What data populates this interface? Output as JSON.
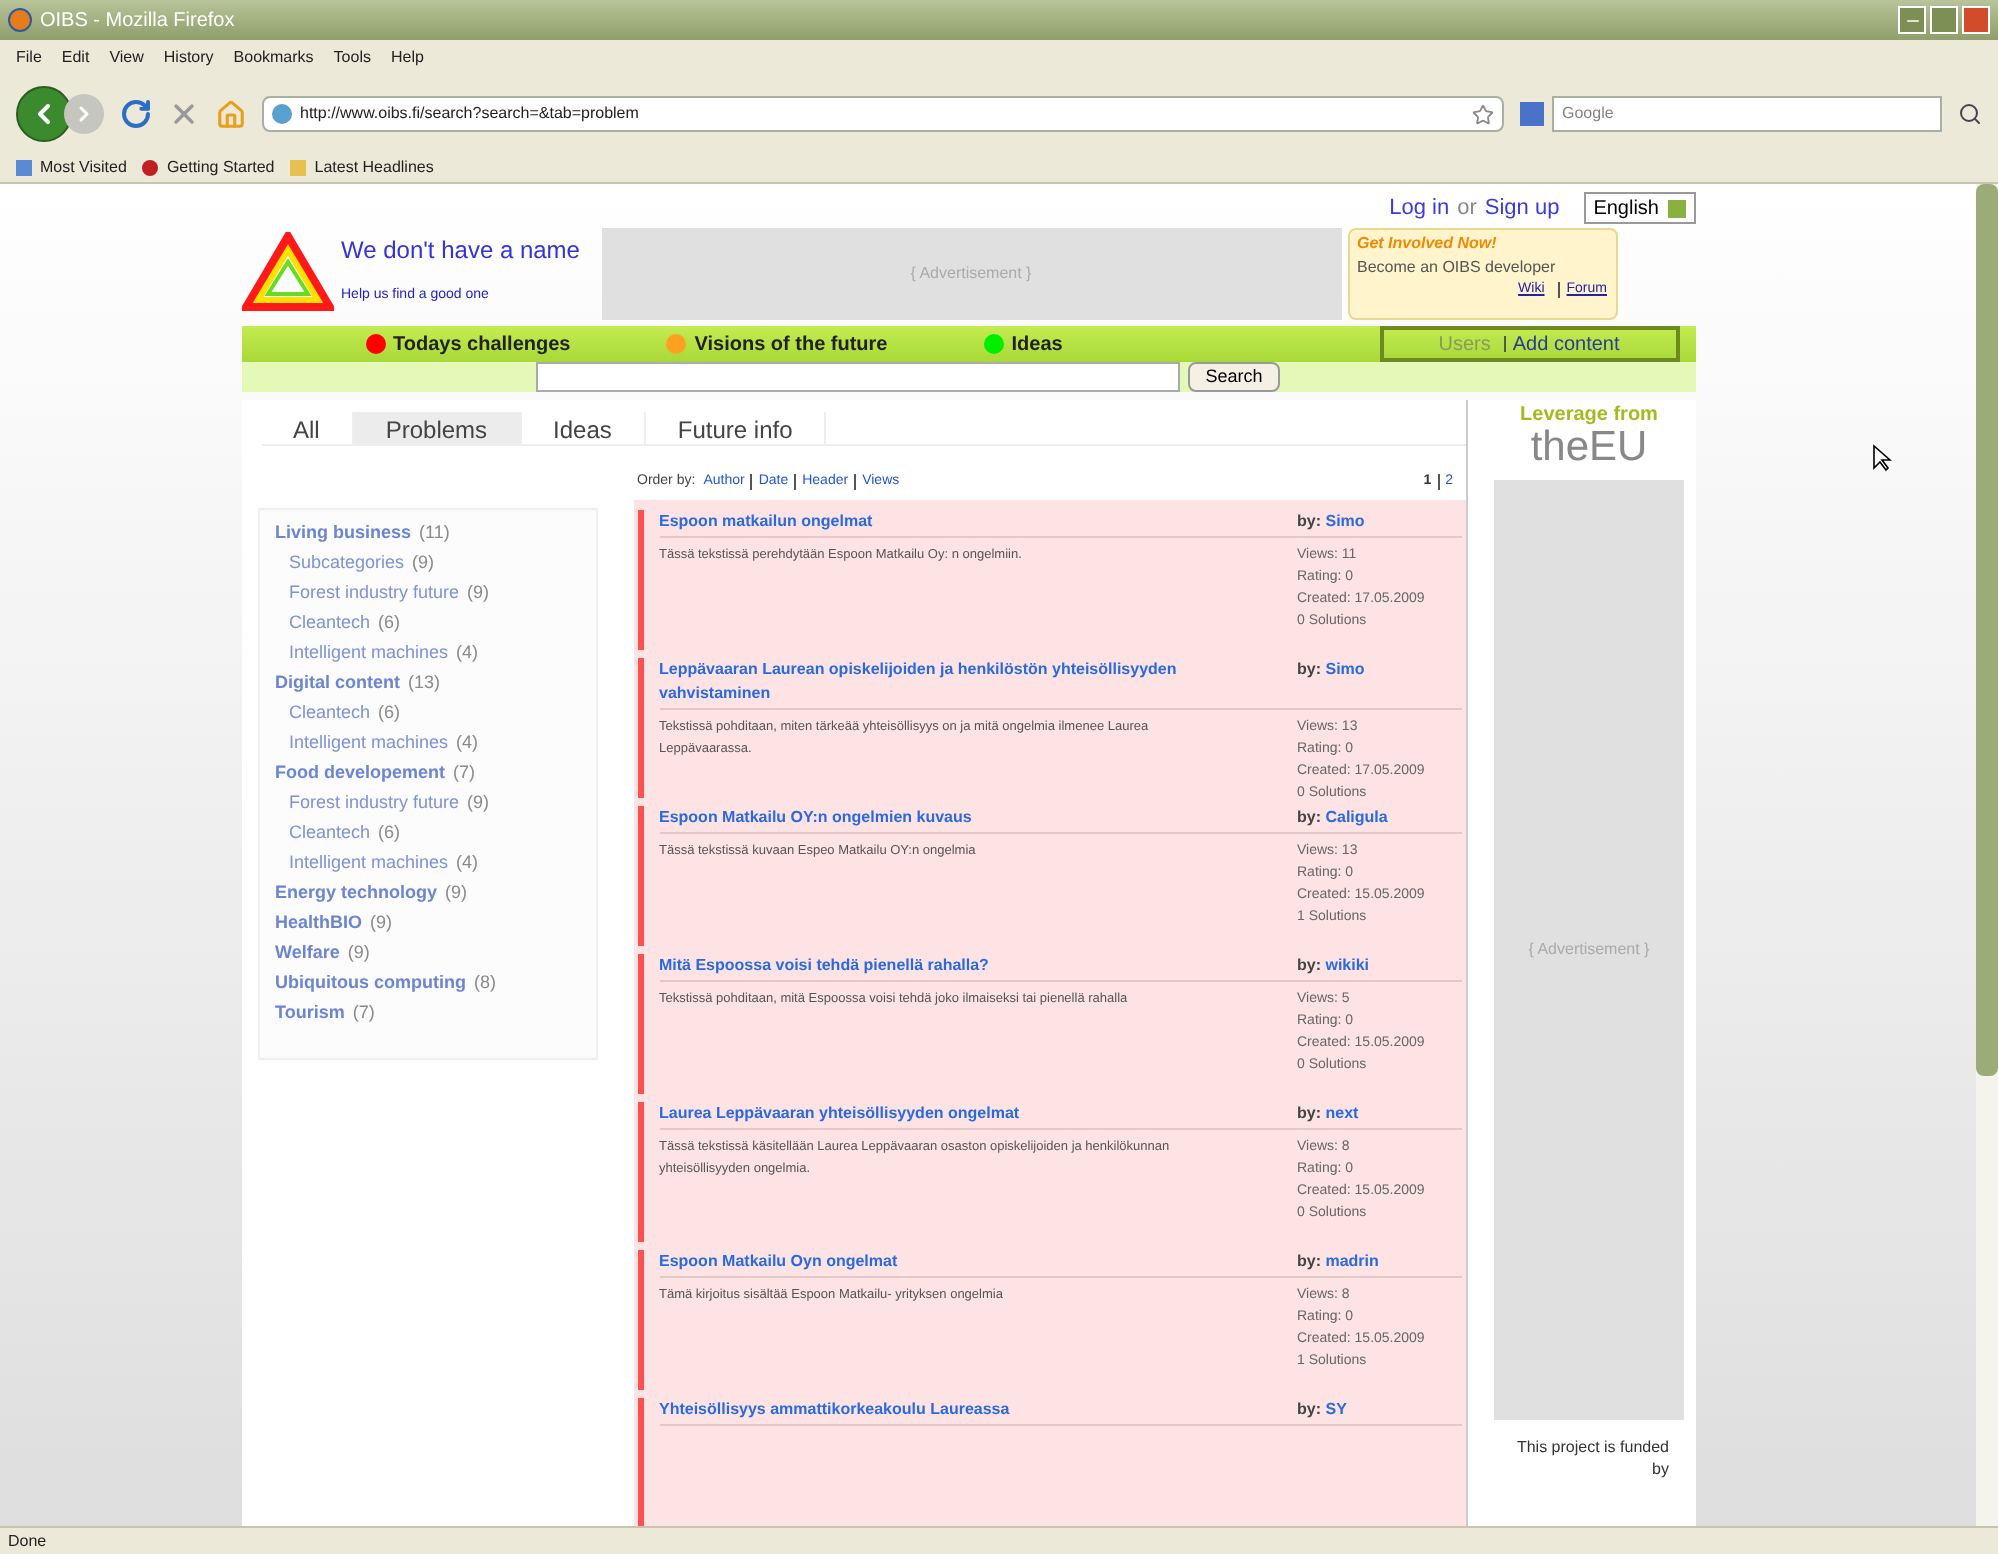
{
  "window": {
    "title": "OIBS - Mozilla Firefox"
  },
  "menu": [
    "File",
    "Edit",
    "View",
    "History",
    "Bookmarks",
    "Tools",
    "Help"
  ],
  "address_bar": {
    "value": "http://www.oibs.fi/search?search=&tab=problem"
  },
  "search_engine": {
    "placeholder": "Google"
  },
  "bookmarks": [
    "Most Visited",
    "Getting Started",
    "Latest Headlines"
  ],
  "page": {
    "auth": {
      "login": "Log in",
      "or": "or",
      "signup": "Sign up"
    },
    "language": "English",
    "site_name": "We don't have a name",
    "site_tagline": "Help us find a good one",
    "ad_top": "{ Advertisement }",
    "involve": {
      "title": "Get Involved Now!",
      "text": "Become an OIBS developer",
      "links": [
        "Wiki",
        "Forum"
      ]
    },
    "nav": [
      {
        "label": "Todays challenges",
        "color": "#ff0000"
      },
      {
        "label": "Visions of the future",
        "color": "#ffa020"
      },
      {
        "label": "Ideas",
        "color": "#00ee00"
      }
    ],
    "user_links": [
      {
        "label": "Users",
        "disabled": true
      },
      {
        "label": "Add content",
        "disabled": false
      }
    ],
    "search_button": "Search",
    "tabs": [
      {
        "label": "All",
        "selected": false
      },
      {
        "label": "Problems",
        "selected": true
      },
      {
        "label": "Ideas",
        "selected": false
      },
      {
        "label": "Future info",
        "selected": false
      }
    ],
    "categories": [
      {
        "name": "Living business",
        "count": "(11)",
        "children": [
          {
            "name": "Subcategories",
            "count": "(9)"
          },
          {
            "name": "Forest industry future",
            "count": "(9)"
          },
          {
            "name": "Cleantech",
            "count": "(6)"
          },
          {
            "name": "Intelligent machines",
            "count": "(4)"
          }
        ]
      },
      {
        "name": "Digital content",
        "count": "(13)",
        "children": [
          {
            "name": "Cleantech",
            "count": "(6)"
          },
          {
            "name": "Intelligent machines",
            "count": "(4)"
          }
        ]
      },
      {
        "name": "Food developement",
        "count": "(7)",
        "children": [
          {
            "name": "Forest industry future",
            "count": "(9)"
          },
          {
            "name": "Cleantech",
            "count": "(6)"
          },
          {
            "name": "Intelligent machines",
            "count": "(4)"
          }
        ]
      },
      {
        "name": "Energy technology",
        "count": "(9)"
      },
      {
        "name": "HealthBIO",
        "count": "(9)"
      },
      {
        "name": "Welfare",
        "count": "(9)"
      },
      {
        "name": "Ubiquitous computing",
        "count": "(8)"
      },
      {
        "name": "Tourism",
        "count": "(7)"
      }
    ],
    "order_by": {
      "label": "Order by:",
      "options": [
        "Author",
        "Date",
        "Header",
        "Views"
      ]
    },
    "pages": [
      {
        "label": "1",
        "selected": true
      },
      {
        "label": "2",
        "selected": false
      }
    ],
    "problems": [
      {
        "title": "Espoon matkailun ongelmat",
        "by": "by:",
        "author": "Simo",
        "text": "Tässä tekstissä perehdytään Espoon Matkailu Oy: n ongelmiin.",
        "views": "Views: 11",
        "rating": "Rating: 0",
        "created": "Created: 17.05.2009",
        "solutions": "0 Solutions"
      },
      {
        "title": "Leppävaaran Laurean opiskelijoiden ja henkilöstön yhteisöllisyyden vahvistaminen",
        "by": "by:",
        "author": "Simo",
        "text": "Tekstissä pohditaan, miten tärkeää yhteisöllisyys on ja mitä ongelmia ilmenee Laurea Leppävaarassa.",
        "views": "Views: 13",
        "rating": "Rating: 0",
        "created": "Created: 17.05.2009",
        "solutions": "0 Solutions"
      },
      {
        "title": "Espoon Matkailu OY:n ongelmien kuvaus",
        "by": "by:",
        "author": "Caligula",
        "text": "Tässä tekstissä kuvaan Espeo Matkailu OY:n ongelmia",
        "views": "Views: 13",
        "rating": "Rating: 0",
        "created": "Created: 15.05.2009",
        "solutions": "1 Solutions"
      },
      {
        "title": "Mitä Espoossa voisi tehdä pienellä rahalla?",
        "by": "by:",
        "author": "wikiki",
        "text": "Tekstissä pohditaan, mitä Espoossa voisi tehdä joko ilmaiseksi tai pienellä rahalla",
        "views": "Views: 5",
        "rating": "Rating: 0",
        "created": "Created: 15.05.2009",
        "solutions": "0 Solutions"
      },
      {
        "title": "Laurea Leppävaaran yhteisöllisyyden ongelmat",
        "by": "by:",
        "author": "next",
        "text": "Tässä tekstissä käsitellään Laurea Leppävaaran osaston opiskelijoiden ja henkilökunnan yhteisöllisyyden ongelmia.",
        "views": "Views: 8",
        "rating": "Rating: 0",
        "created": "Created: 15.05.2009",
        "solutions": "0 Solutions"
      },
      {
        "title": "Espoon Matkailu Oyn ongelmat",
        "by": "by:",
        "author": "madrin",
        "text": "Tämä kirjoitus sisältää Espoon Matkailu- yrityksen ongelmia",
        "views": "Views: 8",
        "rating": "Rating: 0",
        "created": "Created: 15.05.2009",
        "solutions": "1 Solutions"
      },
      {
        "title": "Yhteisöllisyys ammattikorkeakoulu Laureassa",
        "by": "by:",
        "author": "SY"
      }
    ],
    "eu": {
      "headline": "Leverage from",
      "logo": "theEU"
    },
    "ad_side": "{ Advertisement }",
    "funded": "This project is funded by"
  },
  "status_bar": "Done"
}
